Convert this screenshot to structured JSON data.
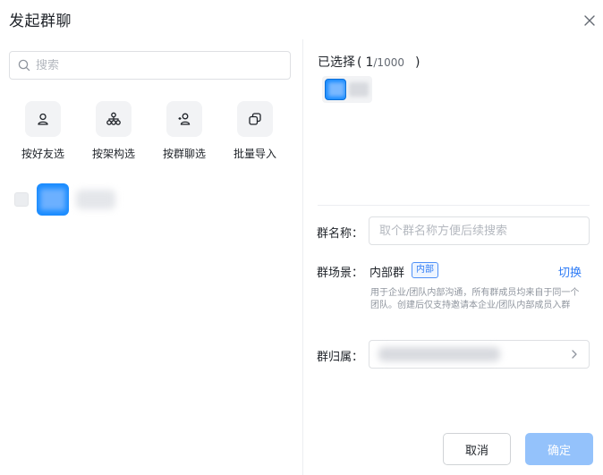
{
  "dialog": {
    "title": "发起群聊"
  },
  "search": {
    "placeholder": "搜索"
  },
  "quick_actions": [
    {
      "label": "按好友选",
      "icon": "person-icon"
    },
    {
      "label": "按架构选",
      "icon": "org-structure-icon"
    },
    {
      "label": "按群聊选",
      "icon": "group-chat-icon"
    },
    {
      "label": "批量导入",
      "icon": "batch-import-icon"
    }
  ],
  "selected": {
    "label": "已选择",
    "open_paren": "(",
    "count": "1",
    "total": "/1000",
    "close_paren": ")"
  },
  "form": {
    "name_label": "群名称：",
    "name_placeholder": "取个群名称方便后续搜索",
    "scene_label": "群场景：",
    "scene_value": "内部群",
    "scene_badge": "内部",
    "switch_label": "切换",
    "scene_desc": "用于企业/团队内部沟通，所有群成员均来自于同一个团队。创建后仅支持邀请本企业/团队内部成员入群",
    "owner_label": "群归属："
  },
  "buttons": {
    "cancel": "取消",
    "confirm": "确定"
  },
  "colors": {
    "accent": "#2f7cf6",
    "confirm_disabled": "#94c2fb",
    "avatar": "#1a8cff"
  }
}
